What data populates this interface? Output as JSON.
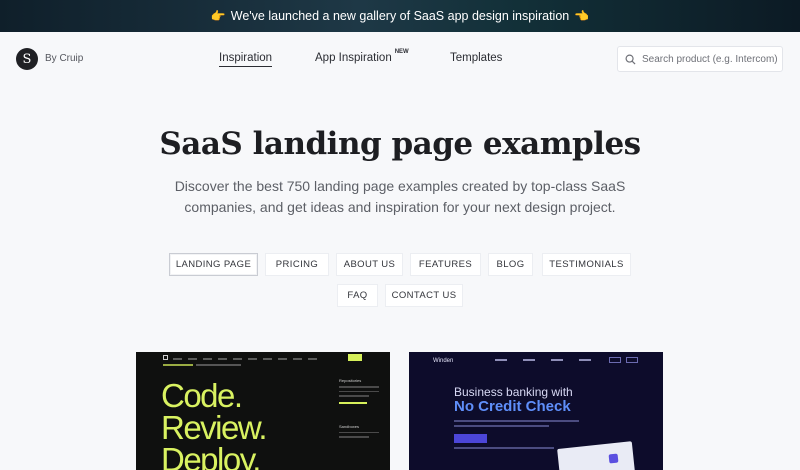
{
  "announcement": {
    "left_emoji": "👉",
    "text": "We've launched a new gallery of SaaS app design inspiration",
    "right_emoji": "👈"
  },
  "header": {
    "logo_letter": "S",
    "by_label": "By Cruip",
    "nav": [
      {
        "label": "Inspiration",
        "active": true
      },
      {
        "label": "App Inspiration",
        "badge": "NEW",
        "active": false
      },
      {
        "label": "Templates",
        "active": false
      }
    ],
    "search_placeholder": "Search product (e.g. Intercom)"
  },
  "hero": {
    "title": "SaaS landing page examples",
    "subtitle": "Discover the best 750 landing page examples created by top-class SaaS companies, and get ideas and inspiration for your next design project."
  },
  "filters": [
    {
      "label": "LANDING PAGE",
      "active": true
    },
    {
      "label": "PRICING",
      "active": false
    },
    {
      "label": "ABOUT US",
      "active": false
    },
    {
      "label": "FEATURES",
      "active": false
    },
    {
      "label": "BLOG",
      "active": false
    },
    {
      "label": "TESTIMONIALS",
      "active": false
    },
    {
      "label": "FAQ",
      "active": false
    },
    {
      "label": "CONTACT US",
      "active": false
    }
  ],
  "cards": [
    {
      "headline_lines": [
        "Code.",
        "Review.",
        "Deploy."
      ],
      "side_title": "Repositories",
      "side_title_2": "Sandboxes",
      "accent": "#d9f261"
    },
    {
      "brand": "Winden",
      "headline": "Business banking with",
      "headline_highlight": "No Credit Check",
      "accent": "#5f8ffa"
    }
  ],
  "colors": {
    "accent_dark": "#1d1e22",
    "background": "#f7f8fa"
  }
}
